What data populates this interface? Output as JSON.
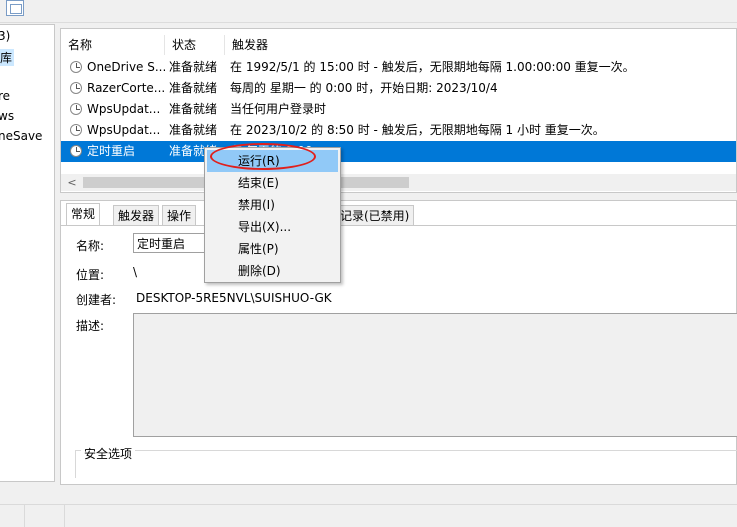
{
  "left_tree": {
    "items": [
      "3)",
      "库",
      "re",
      "ws",
      "neSave"
    ]
  },
  "task_list": {
    "columns": [
      "名称",
      "状态",
      "触发器"
    ],
    "rows": [
      {
        "name": "OneDrive S...",
        "status": "准备就绪",
        "trigger": "在 1992/5/1 的 15:00 时 - 触发后，无限期地每隔 1.00:00:00 重复一次。"
      },
      {
        "name": "RazerCorte...",
        "status": "准备就绪",
        "trigger": "每周的 星期一 的 0:00 时，开始日期: 2023/10/4"
      },
      {
        "name": "WpsUpdat...",
        "status": "准备就绪",
        "trigger": "当任何用户登录时"
      },
      {
        "name": "WpsUpdat...",
        "status": "准备就绪",
        "trigger": "在 2023/10/2 的 8:50 时 - 触发后，无限期地每隔 1 小时 重复一次。"
      },
      {
        "name": "定时重启",
        "status": "准备就绪",
        "trigger": "在 每天的 0:00"
      }
    ],
    "scroll_left": "<"
  },
  "detail": {
    "tabs": [
      "常规",
      "触发器",
      "操作"
    ],
    "tab_history": "记录(已禁用)",
    "name_label": "名称:",
    "name_value": "定时重启",
    "location_label": "位置:",
    "location_value": "\\",
    "author_label": "创建者:",
    "author_value": "DESKTOP-5RE5NVL\\SUISHUO-GK",
    "description_label": "描述:",
    "security_label": "安全选项"
  },
  "context_menu": {
    "items": [
      "运行(R)",
      "结束(E)",
      "禁用(I)",
      "导出(X)...",
      "属性(P)",
      "删除(D)"
    ]
  },
  "colors": {
    "selection": "#0078d7",
    "menu_hover": "#91c9f7",
    "annotation_circle": "#e0201c"
  }
}
